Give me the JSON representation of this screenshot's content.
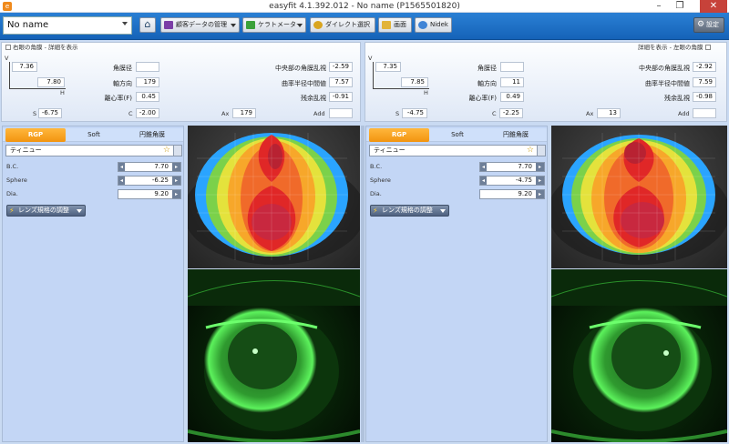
{
  "window": {
    "title": "easyfit 4.1.392.012  - No name (P1565501820)",
    "app_icon": "easyfit-logo",
    "controls": [
      "minimize-icon",
      "restore-icon",
      "close-icon"
    ]
  },
  "toolbar": {
    "patient_name": "No name",
    "home_icon": "home-icon",
    "buttons": [
      {
        "label": "顧客データの管理",
        "icon": "customer-data-icon",
        "dropdown": true
      },
      {
        "label": "ケラトメーター",
        "icon": "keratometer-icon",
        "dropdown": true
      },
      {
        "label": "ダイレクト選択",
        "icon": "direct-select-icon",
        "dropdown": false
      },
      {
        "label": "画面",
        "icon": "screen-icon",
        "dropdown": false
      },
      {
        "label": "Nidek",
        "icon": "nidek-icon",
        "dropdown": false
      }
    ],
    "settings_label": "設定"
  },
  "right_eye": {
    "header_check_label": "右眼の角膜 - 詳細を表示",
    "axis_v": "V",
    "axis_h": "H",
    "k_v": "7.36",
    "k_h": "7.80",
    "angle_dia_label": "角膜径",
    "angle_dia_value": "",
    "axis_label": "軸方向",
    "axis_value": "179",
    "ecc_label": "離心率(F)",
    "ecc_value": "0.45",
    "central_astig_label": "中央部の角膜乱視",
    "central_astig_value": "-2.59",
    "mean_radius_label": "曲率半径中間値",
    "mean_radius_value": "7.57",
    "residual_astig_label": "残余乱視",
    "residual_astig_value": "-0.91",
    "s_label": "S",
    "s_value": "-6.75",
    "c_label": "C",
    "c_value": "-2.00",
    "ax_label": "Ax",
    "ax_value": "179",
    "add_label": "Add",
    "add_value": "",
    "tabs": [
      "RGP",
      "Soft",
      "円錐角膜"
    ],
    "active_tab": "RGP",
    "lens_name": "ティニュー",
    "bc_label": "B.C.",
    "bc_value": "7.70",
    "sphere_label": "Sphere",
    "sphere_value": "-6.25",
    "dia_label": "Dia.",
    "dia_value": "9.20",
    "adjust_label": "レンズ規格の調整"
  },
  "left_eye": {
    "header_check_label": "詳細を表示 - 左眼の角膜",
    "k_v": "7.35",
    "k_h": "7.85",
    "angle_dia_label": "角膜径",
    "angle_dia_value": "",
    "axis_label": "軸方向",
    "axis_value": "11",
    "ecc_label": "離心率(F)",
    "ecc_value": "0.49",
    "central_astig_label": "中央部の角膜乱視",
    "central_astig_value": "-2.92",
    "mean_radius_label": "曲率半径中間値",
    "mean_radius_value": "7.59",
    "residual_astig_label": "残余乱視",
    "residual_astig_value": "-0.98",
    "s_label": "S",
    "s_value": "-4.75",
    "c_label": "C",
    "c_value": "-2.25",
    "ax_label": "Ax",
    "ax_value": "13",
    "add_label": "Add",
    "add_value": "",
    "tabs": [
      "RGP",
      "Soft",
      "円錐角膜"
    ],
    "active_tab": "RGP",
    "lens_name": "ティニュー",
    "bc_label": "B.C.",
    "bc_value": "7.70",
    "sphere_label": "Sphere",
    "sphere_value": "-4.75",
    "dia_label": "Dia.",
    "dia_value": "9.20",
    "adjust_label": "レンズ規格の調整"
  },
  "colors": {
    "toolbar_blue": "#1a6cc4",
    "tab_orange": "#f29410",
    "fluorescein_green": "#3fd63f",
    "panel_bg": "#c3d6f5"
  }
}
